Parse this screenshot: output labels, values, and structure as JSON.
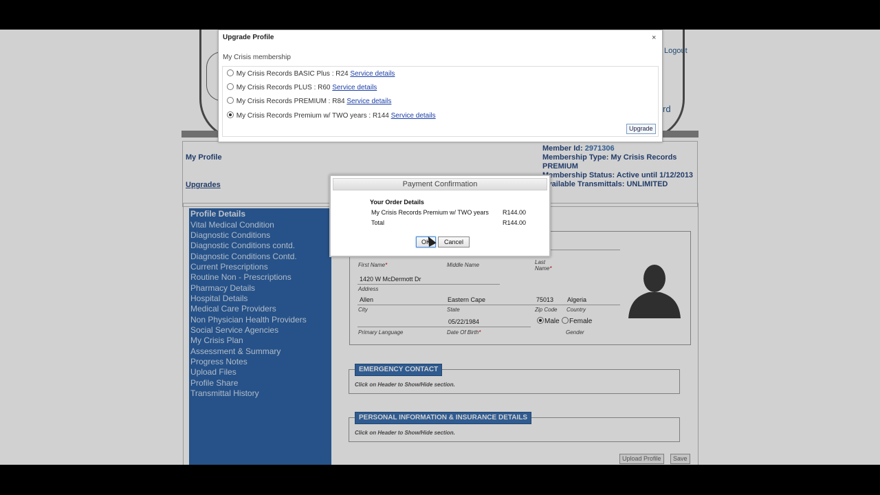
{
  "upgrade_modal": {
    "title": "Upgrade Profile",
    "close_symbol": "×",
    "subtitle": "My Crisis membership",
    "options": [
      {
        "label": "My Crisis Records BASIC Plus : R24",
        "link": "Service details",
        "selected": false
      },
      {
        "label": "My Crisis Records PLUS : R60",
        "link": "Service details",
        "selected": false
      },
      {
        "label": "My Crisis Records PREMIUM : R84",
        "link": "Service details",
        "selected": false
      },
      {
        "label": "My Crisis Records Premium w/ TWO years : R144",
        "link": "Service details",
        "selected": true
      }
    ],
    "upgrade_button": "Upgrade"
  },
  "payment": {
    "title": "Payment Confirmation",
    "heading": "Your Order Details",
    "item_name": "My Crisis Records Premium w/ TWO years",
    "item_price": "R144.00",
    "total_label": "Total",
    "total_price": "R144.00",
    "ok_label": "OK",
    "cancel_label": "Cancel"
  },
  "header": {
    "logout": "Logout",
    "title_fragment": "rd"
  },
  "profile_strip": {
    "my_profile": "My Profile",
    "upgrades": "Upgrades",
    "member_id_label": "Member Id:",
    "member_id": "2971306",
    "membership_type": "Membership Type: My Crisis Records PREMIUM",
    "membership_status": "Membership Status: Active until 1/12/2013",
    "available_transmittals": "Available Transmittals: UNLIMITED"
  },
  "sidebar": {
    "title": "Profile Details",
    "items": [
      "Vital Medical Condition",
      "Diagnostic Conditions",
      "Diagnostic Conditions contd.",
      "Diagnostic Conditions Contd.",
      "Current Prescriptions",
      "Routine Non - Prescriptions",
      "Pharmacy Details",
      "Hospital Details",
      "Medical Care Providers",
      "Non Physician Health Providers",
      "Social Service Agencies",
      "My Crisis Plan",
      "Assessment & Summary",
      "Progress Notes",
      "Upload Files",
      "Profile Share",
      "Transmittal History"
    ]
  },
  "form": {
    "first_name_label": "First Name",
    "middle_name_label": "Middle Name",
    "last_name_label": "Last Name",
    "address_value": "1420 W McDermott Dr",
    "address_label": "Address",
    "city_value": "Allen",
    "city_label": "City",
    "state_value": "Eastern Cape",
    "state_label": "State",
    "zip_value": "75013",
    "zip_label": "Zip Code",
    "country_value": "Algeria",
    "country_label": "Country",
    "dob_value": "05/22/1984",
    "dob_label": "Date Of Birth",
    "primary_language_label": "Primary Language",
    "gender_label": "Gender",
    "male_label": "Male",
    "female_label": "Female",
    "required_mark": "*"
  },
  "sections": {
    "emergency_title": "EMERGENCY CONTACT",
    "emergency_hint": "Click on Header to Show/Hide section.",
    "personal_title": "PERSONAL INFORMATION & INSURANCE DETAILS",
    "personal_hint": "Click on Header to Show/Hide section."
  },
  "footer_buttons": {
    "upload_profile": "Upload Profile",
    "save": "Save"
  }
}
